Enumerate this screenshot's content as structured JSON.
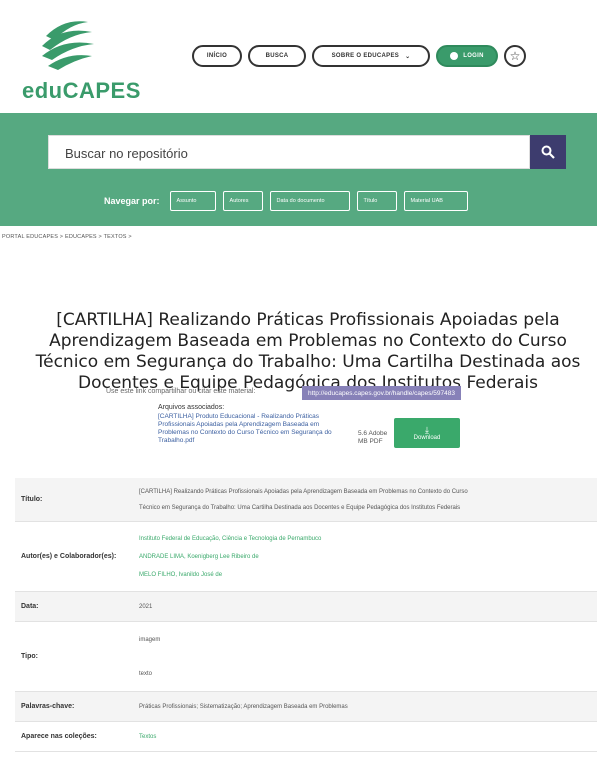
{
  "brand": {
    "name": "eduCAPES",
    "color": "#3a9b6b"
  },
  "nav": {
    "items": [
      "INÍCIO",
      "BUSCA",
      "SOBRE O EDUCAPES"
    ],
    "login_label": "LOGIN",
    "favorite_icon": "star-icon"
  },
  "search": {
    "placeholder": "Buscar no repositório",
    "icon": "search-icon"
  },
  "browse": {
    "label": "Navegar por:",
    "items": [
      "Assunto",
      "Autores",
      "Data do documento",
      "Título",
      "Material UAB"
    ]
  },
  "breadcrumb": "PORTAL EDUCAPES > EDUCAPES > TEXTOS >",
  "item": {
    "title": "[CARTILHA] Realizando Práticas Profissionais Apoiadas pela Aprendizagem Baseada em Problemas no Contexto do Curso Técnico em Segurança do Trabalho: Uma Cartilha Destinada aos Docentes e Equipe Pedagógica dos Institutos Federais",
    "cite_label": "Use este link compartilhar ou citar este material:",
    "cite_url": "http://educapes.capes.gov.br/handle/capes/597483"
  },
  "files": {
    "heading": "Arquivos associados:",
    "file_name": "[CARTILHA] Produto Educacional - Realizando Práticas Profissionais Apoiadas pela Aprendizagem Baseada em Problemas no Contexto do Curso Técnico em Segurança do Trabalho.pdf",
    "file_size": "5.6 Adobe MB PDF",
    "download_label": "Download"
  },
  "metadata": {
    "titulo_label": "Título:",
    "titulo_lines": [
      "[CARTILHA] Realizando Práticas Profissionais Apoiadas pela Aprendizagem Baseada em Problemas no Contexto do Curso",
      "Técnico em Segurança do Trabalho: Uma Cartilha Destinada aos Docentes e Equipe Pedagógica dos Institutos Federais"
    ],
    "autor_label": "Autor(es) e Colaborador(es):",
    "autor_lines": [
      "Instituto Federal de Educação, Ciência e Tecnologia de Pernambuco",
      "ANDRADE LIMA, Koenigberg Lee Ribeiro de",
      "MELO FILHO, Ivanildo José de"
    ],
    "data_label": "Data:",
    "data_value": "2021",
    "tipo_label": "Tipo:",
    "tipo_lines": [
      "imagem",
      "texto"
    ],
    "palavras_label": "Palavras-chave:",
    "palavras_value": "Práticas Profissionais; Sistematização; Aprendizagem Baseada em Problemas",
    "colecoes_label": "Aparece nas coleções:",
    "colecoes_value": "Textos"
  }
}
